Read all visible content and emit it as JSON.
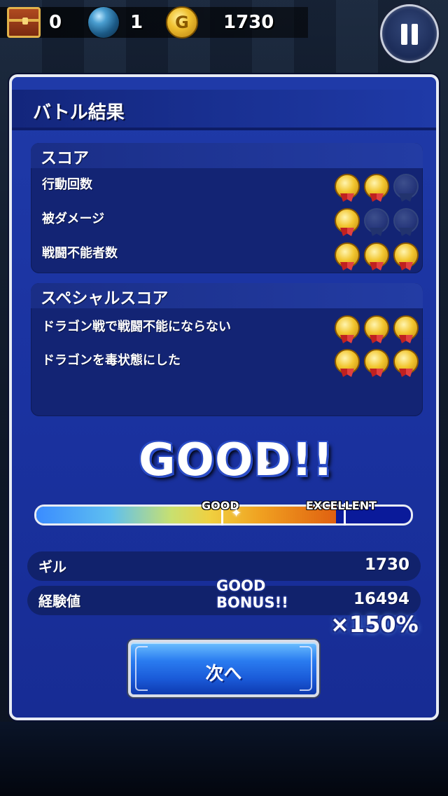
{
  "status_bar": {
    "chest_count": "0",
    "orb_count": "1",
    "gil_icon_glyph": "G",
    "gil_amount": "1730",
    "pause_icon": "pause-icon"
  },
  "dialog": {
    "title": "バトル結果",
    "score_panel": {
      "header": "スコア",
      "rows": [
        {
          "label": "行動回数",
          "medals_earned": 2,
          "medals_total": 3
        },
        {
          "label": "被ダメージ",
          "medals_earned": 1,
          "medals_total": 3
        },
        {
          "label": "戦闘不能者数",
          "medals_earned": 3,
          "medals_total": 3
        }
      ]
    },
    "special_panel": {
      "header": "スペシャルスコア",
      "rows": [
        {
          "label": "ドラゴン戦で戦闘不能にならない",
          "medals_earned": 3,
          "medals_total": 3
        },
        {
          "label": "ドラゴンを毒状態にした",
          "medals_earned": 3,
          "medals_total": 3
        }
      ]
    },
    "rank": "GOOD!!",
    "gauge": {
      "good_label": "GOOD",
      "excellent_label": "EXCELLENT",
      "fill_fraction": 0.8
    },
    "results": {
      "gil_label": "ギル",
      "gil_value": "1730",
      "exp_label": "経験値",
      "exp_value": "16494"
    },
    "bonus": {
      "line1": "GOOD",
      "line2": "BONUS!!",
      "multiplier": "×150%"
    },
    "next_button": "次へ"
  },
  "colors": {
    "dialog_bg": "#1f3aa8",
    "panel_bg": "#132474",
    "border": "#e8ecf4",
    "medal_gold": "#f2c630",
    "button_blue": "#2a7cf0"
  }
}
